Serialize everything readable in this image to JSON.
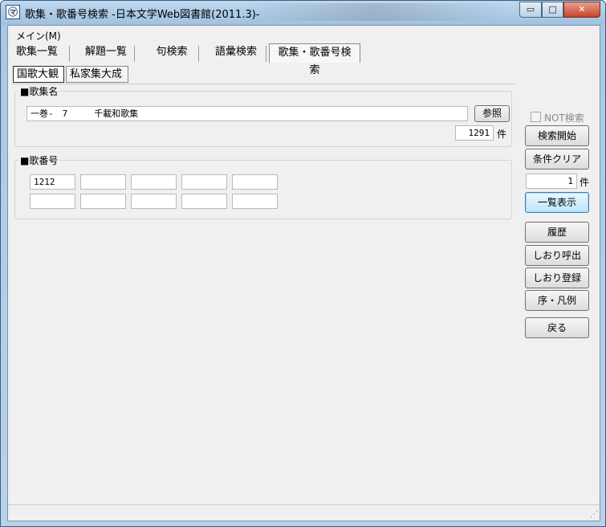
{
  "window": {
    "title": "歌集・歌番号検索 -日本文学Web図書館(2011.3)-",
    "icon_glyph": "㋮",
    "min_glyph": "▭",
    "max_glyph": "□",
    "close_glyph": "✕"
  },
  "menu": {
    "main_label": "メイン(M)"
  },
  "tabs": [
    {
      "label": "歌集一覧"
    },
    {
      "label": "解題一覧"
    },
    {
      "label": "句検索"
    },
    {
      "label": "語彙検索"
    },
    {
      "label": "歌集・歌番号検索"
    }
  ],
  "subtabs": [
    {
      "label": "国歌大観"
    },
    {
      "label": "私家集大成"
    }
  ],
  "collection_group": {
    "title": "■歌集名",
    "name_value": "一巻-　7　　　千載和歌集",
    "ref_button": "参照",
    "count_value": "1291",
    "count_unit": "件"
  },
  "number_group": {
    "title": "■歌番号",
    "fields": [
      "1212",
      "",
      "",
      "",
      "",
      "",
      "",
      "",
      "",
      ""
    ]
  },
  "side_panel": {
    "not_search_label": "NOT検索",
    "search_start": "検索開始",
    "clear_conditions": "条件クリア",
    "result_count": "1",
    "result_unit": "件",
    "list_display": "一覧表示",
    "history": "履歴",
    "bookmark_call": "しおり呼出",
    "bookmark_register": "しおり登録",
    "preface_legend": "序・凡例",
    "back": "戻る"
  }
}
